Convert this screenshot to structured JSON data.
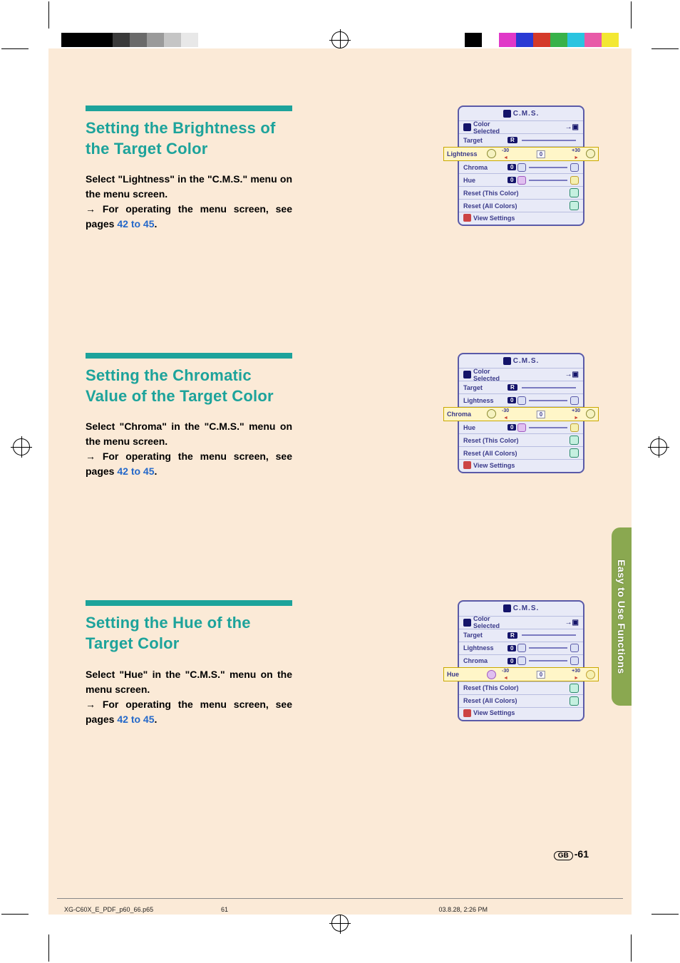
{
  "sections": [
    {
      "heading": "Setting the Brightness of the Target Color",
      "body_prefix": "Select \"Lightness\" in the \"C.M.S.\" menu on the menu screen.",
      "body_arrow": "→",
      "body_mid": " For operating the menu screen, see pages ",
      "body_link": "42 to 45",
      "body_suffix": ".",
      "osd": {
        "title": "C.M.S.",
        "row_color_selected": "Color Selected",
        "row_target": "Target",
        "target_val": "R",
        "highlight_label": "Lightness",
        "highlight_min": "-30",
        "highlight_max": "+30",
        "highlight_zero": "0",
        "row_chroma": "Chroma",
        "chroma_val": "0",
        "row_hue": "Hue",
        "hue_val": "0",
        "row_reset_this": "Reset (This Color)",
        "row_reset_all": "Reset (All Colors)",
        "row_view": "View Settings"
      }
    },
    {
      "heading": "Setting the Chromatic Value of the Target Color",
      "body_prefix": "Select \"Chroma\" in the \"C.M.S.\" menu on the menu screen.",
      "body_arrow": "→",
      "body_mid": " For operating the menu screen, see pages ",
      "body_link": "42 to 45",
      "body_suffix": ".",
      "osd": {
        "title": "C.M.S.",
        "row_color_selected": "Color Selected",
        "row_target": "Target",
        "target_val": "R",
        "row_lightness": "Lightness",
        "lightness_val": "0",
        "highlight_label": "Chroma",
        "highlight_min": "-30",
        "highlight_max": "+30",
        "highlight_zero": "0",
        "row_hue": "Hue",
        "hue_val": "0",
        "row_reset_this": "Reset (This Color)",
        "row_reset_all": "Reset (All Colors)",
        "row_view": "View Settings"
      }
    },
    {
      "heading": "Setting the Hue of the Target Color",
      "body_prefix": "Select \"Hue\" in the \"C.M.S.\" menu on the menu screen.",
      "body_arrow": "→",
      "body_mid": " For operating the menu screen, see pages ",
      "body_link": "42 to 45",
      "body_suffix": ".",
      "osd": {
        "title": "C.M.S.",
        "row_color_selected": "Color Selected",
        "row_target": "Target",
        "target_val": "R",
        "row_lightness": "Lightness",
        "lightness_val": "0",
        "row_chroma": "Chroma",
        "chroma_val": "0",
        "highlight_label": "Hue",
        "highlight_min": "-30",
        "highlight_max": "+30",
        "highlight_zero": "0",
        "row_reset_this": "Reset (This Color)",
        "row_reset_all": "Reset (All Colors)",
        "row_view": "View Settings"
      }
    }
  ],
  "side_tab": "Easy to Use Functions",
  "page_badge": "GB",
  "page_num": "-61",
  "footer": {
    "filename": "XG-C60X_E_PDF_p60_66.p65",
    "page": "61",
    "datetime": "03.8.28, 2:26 PM"
  },
  "colorbar_left": [
    "#000",
    "#000",
    "#000",
    "#3a3a3a",
    "#6a6a6a",
    "#9a9a9a",
    "#c5c5c5",
    "#e8e8e8",
    "#fff"
  ],
  "colorbar_right": [
    "#f3e832",
    "#e85aa8",
    "#2ac4e0",
    "#38b24a",
    "#d43a2a",
    "#2a3ad4",
    "#e038c8",
    "#fff",
    "#000"
  ]
}
